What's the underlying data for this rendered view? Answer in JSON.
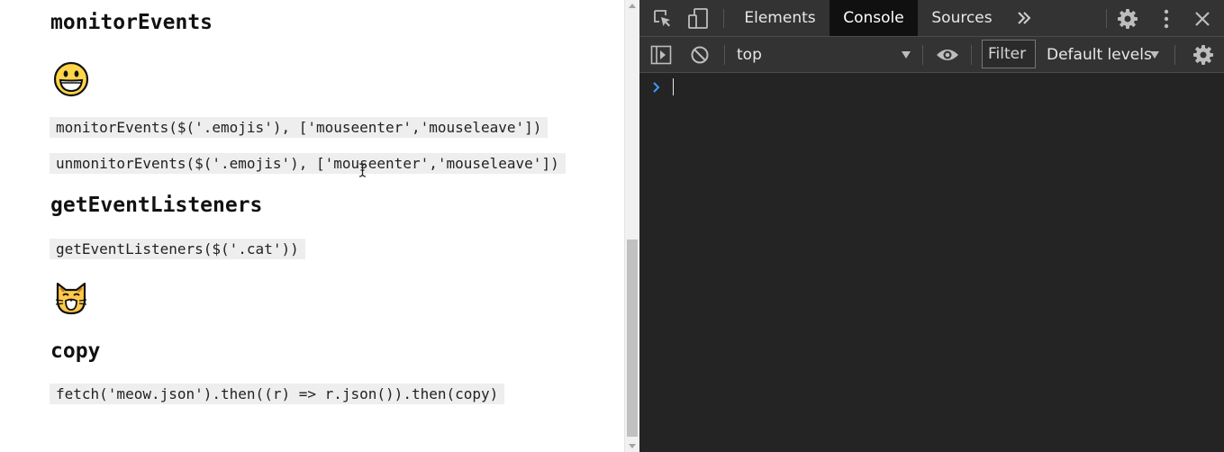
{
  "page": {
    "monitor_heading": "monitorEvents",
    "monitor_code": "monitorEvents($('.emojis'), ['mouseenter','mouseleave'])",
    "unmonitor_code": "unmonitorEvents($('.emojis'), ['mouseenter','mouseleave'])",
    "listeners_heading": "getEventListeners",
    "listeners_code": "getEventListeners($('.cat'))",
    "copy_heading": "copy",
    "copy_code": "fetch('meow.json').then((r) => r.json()).then(copy)",
    "emojis": [
      "grinning-face",
      "cat-face"
    ]
  },
  "devtools": {
    "tabs": [
      "Elements",
      "Console",
      "Sources"
    ],
    "active_tab": "Console",
    "context": "top",
    "filter_placeholder": "Filter",
    "levels": "Default levels",
    "colors": {
      "panel": "#242424",
      "toolbar": "#333333",
      "active_tab": "#101010",
      "prompt": "#3b9dff"
    }
  }
}
